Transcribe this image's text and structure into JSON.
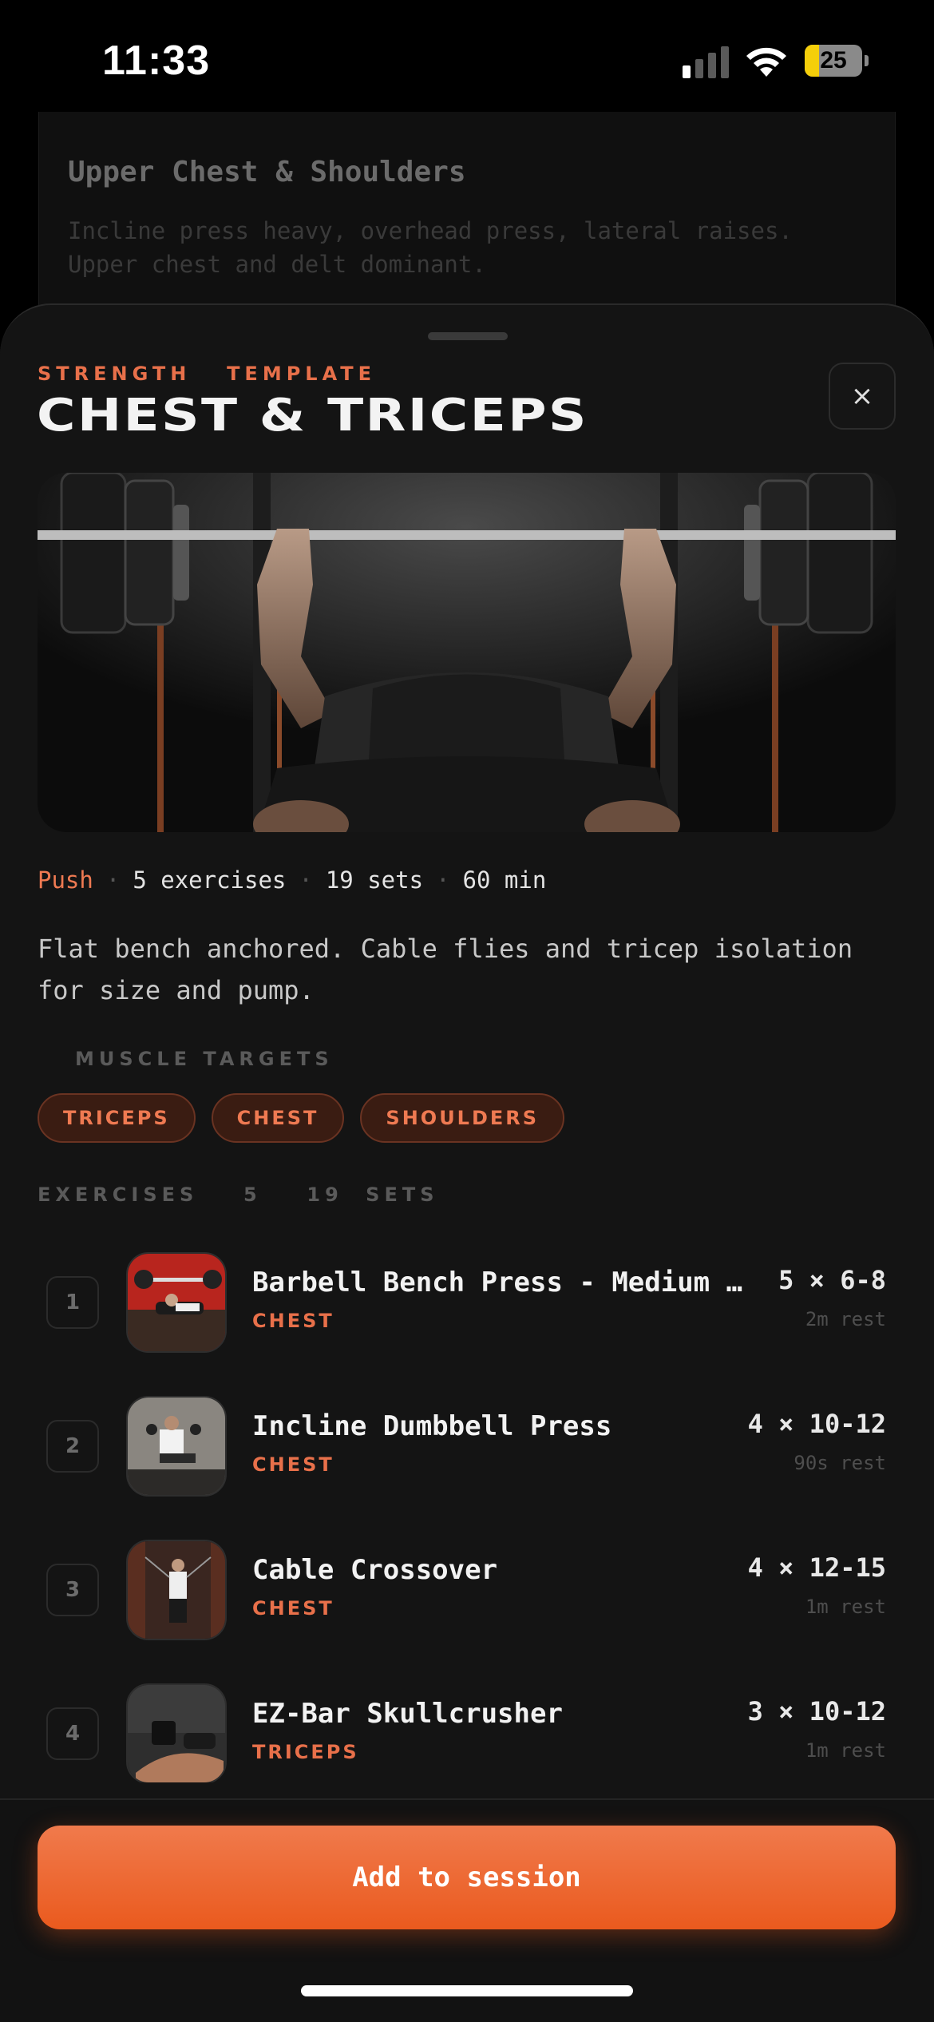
{
  "status": {
    "time": "11:33",
    "battery": "25",
    "battery_level": 0.25
  },
  "background_card": {
    "title": "Upper Chest & Shoulders",
    "description": "Incline press heavy, overhead press, lateral raises. Upper chest and delt dominant."
  },
  "sheet": {
    "eyebrow": "STRENGTH  TEMPLATE",
    "title": "CHEST & TRICEPS",
    "close_icon": "×",
    "meta": {
      "category": "Push",
      "exercises": "5 exercises",
      "sets": "19 sets",
      "duration": "60 min"
    },
    "description": "Flat bench anchored. Cable flies and tricep isolation for size and pump.",
    "muscle_targets_label": "MUSCLE TARGETS",
    "muscle_targets": [
      "TRICEPS",
      "CHEST",
      "SHOULDERS"
    ],
    "exercises_label": "EXERCISES  5  19 SETS",
    "exercises": [
      {
        "index": "1",
        "name": "Barbell Bench Press - Medium Grip",
        "muscle": "CHEST",
        "sets": "5 × 6-8",
        "rest": "2m rest"
      },
      {
        "index": "2",
        "name": "Incline Dumbbell Press",
        "muscle": "CHEST",
        "sets": "4 × 10-12",
        "rest": "90s rest"
      },
      {
        "index": "3",
        "name": "Cable Crossover",
        "muscle": "CHEST",
        "sets": "4 × 12-15",
        "rest": "1m rest"
      },
      {
        "index": "4",
        "name": "EZ-Bar Skullcrusher",
        "muscle": "TRICEPS",
        "sets": "3 × 10-12",
        "rest": "1m rest"
      }
    ],
    "cta": "Add to session"
  },
  "colors": {
    "accent": "#ea5a1e",
    "accent_text": "#e8704a",
    "sheet_bg": "#141414"
  }
}
